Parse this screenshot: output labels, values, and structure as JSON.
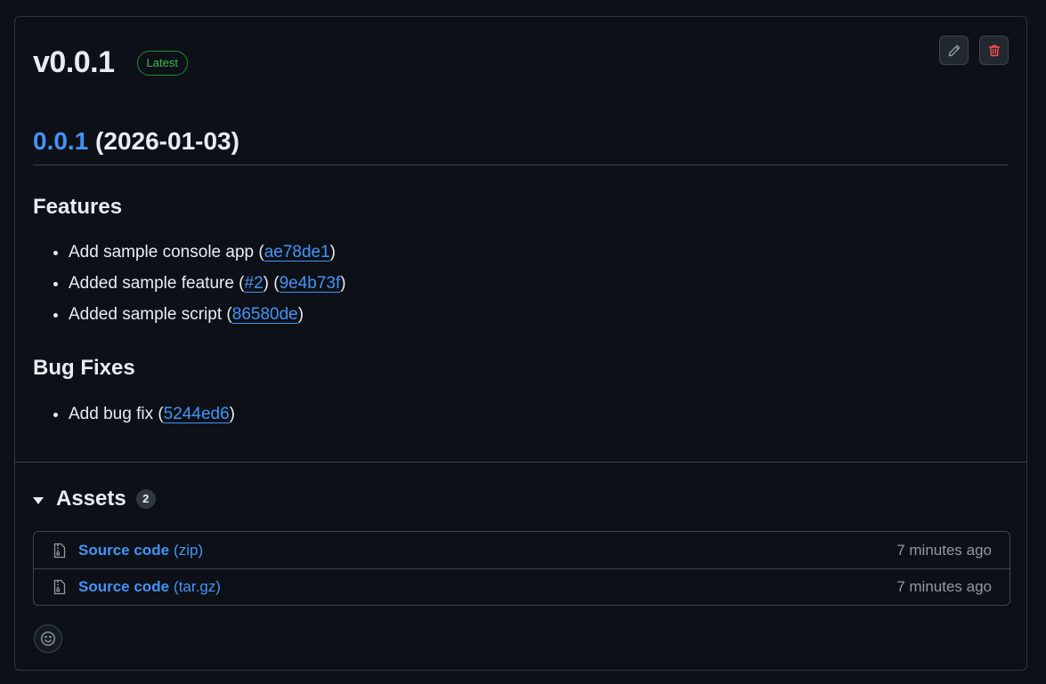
{
  "release": {
    "title": "v0.0.1",
    "badge": "Latest"
  },
  "actions": {
    "edit_icon": "pencil-icon",
    "delete_icon": "trash-icon",
    "delete_color": "#f85149"
  },
  "notes": {
    "version_link": "0.0.1",
    "version_date": " (2026-01-03)",
    "features_heading": "Features",
    "features": [
      {
        "text": "Add sample console app (",
        "links": [
          "ae78de1"
        ],
        "end": ")"
      },
      {
        "text": "Added sample feature (",
        "pr": "#2",
        "mid": ") (",
        "commit": "9e4b73f",
        "end": ")"
      },
      {
        "text": "Added sample script (",
        "links": [
          "86580de"
        ],
        "end": ")"
      }
    ],
    "bugs_heading": "Bug Fixes",
    "bugs": [
      {
        "text": "Add bug fix (",
        "links": [
          "5244ed6"
        ],
        "end": ")"
      }
    ]
  },
  "assets": {
    "title": "Assets",
    "count": "2",
    "items": [
      {
        "name": "Source code",
        "ext": "(zip)",
        "time": "7 minutes ago"
      },
      {
        "name": "Source code",
        "ext": "(tar.gz)",
        "time": "7 minutes ago"
      }
    ]
  },
  "reactions": {
    "icon": "smiley-icon"
  }
}
